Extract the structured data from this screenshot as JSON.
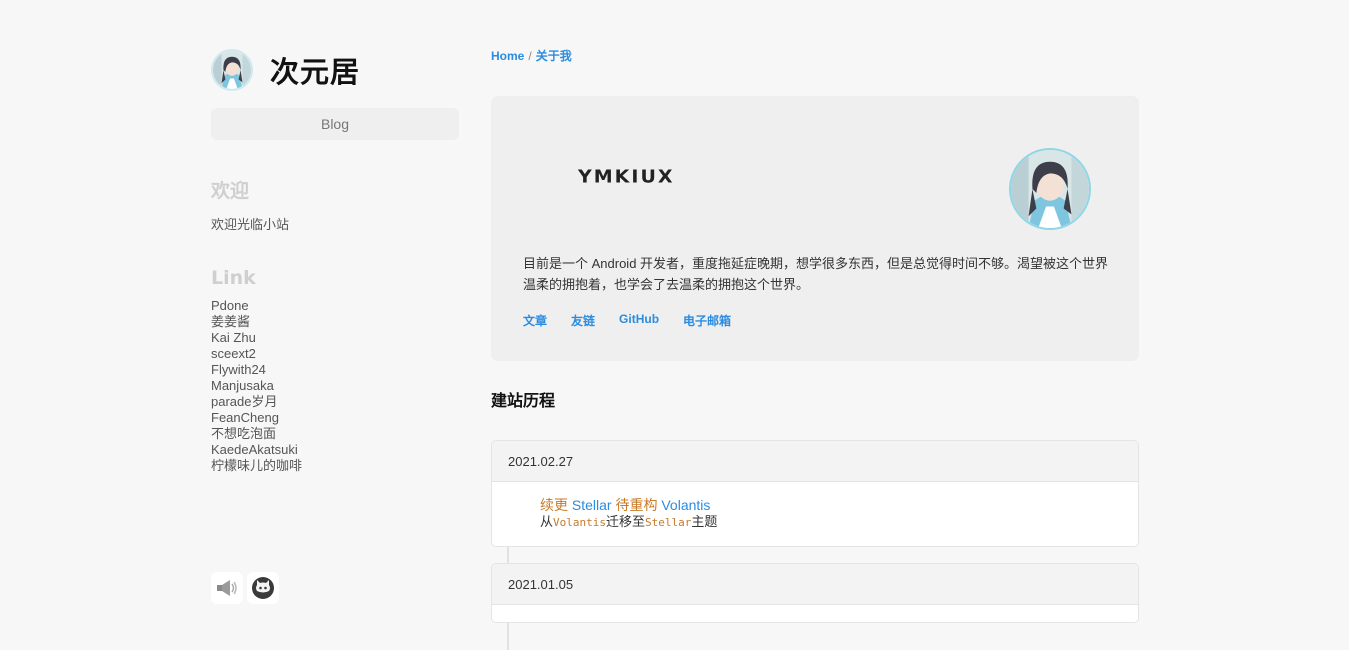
{
  "sidebar": {
    "title": "次元居",
    "nav_blog": "Blog",
    "welcome_heading": "欢迎",
    "welcome_text": "欢迎光临小站",
    "links_heading": "Link",
    "links": [
      "Pdone",
      "姜姜酱",
      "Kai Zhu",
      "sceext2",
      "Flywith24",
      "Manjusaka",
      "parade岁月",
      "FeanCheng",
      "不想吃泡面",
      "KaedeAkatsuki",
      "柠檬味儿的咖啡"
    ],
    "social_icons": [
      "megaphone-icon",
      "github-icon"
    ]
  },
  "breadcrumb": {
    "home": "Home",
    "separator": "/",
    "current": "关于我"
  },
  "about": {
    "logo_text": "YMKIUX",
    "description": "目前是一个 Android 开发者，重度拖延症晚期，想学很多东西，但是总觉得时间不够。渴望被这个世界温柔的拥抱着，也学会了去温柔的拥抱这个世界。",
    "links": [
      "文章",
      "友链",
      "GitHub",
      "电子邮箱"
    ]
  },
  "history": {
    "title": "建站历程",
    "entries": [
      {
        "date": "2021.02.27",
        "line1_a": "续更",
        "line1_b": " Stellar ",
        "line1_c": "待重构",
        "line1_d": " Volantis",
        "line2_a": "从",
        "line2_b": "Volantis",
        "line2_c": "迁移至",
        "line2_d": "Stellar",
        "line2_e": "主题"
      },
      {
        "date": "2021.01.05"
      }
    ]
  },
  "colors": {
    "accent": "#2b8ce0",
    "orange": "#c87a28",
    "page_bg": "#f7f7f7",
    "card_bg": "#efefef"
  }
}
